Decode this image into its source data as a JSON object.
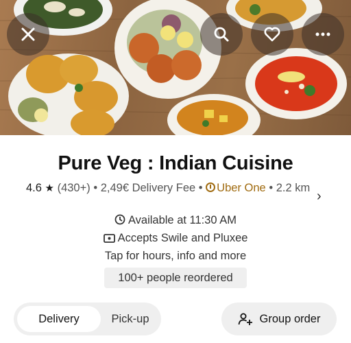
{
  "restaurant": {
    "name": "Pure Veg : Indian Cuisine",
    "rating": "4.6",
    "rating_count": "(430+)",
    "delivery_fee": "2,49€ Delivery Fee",
    "membership": "Uber One",
    "distance": "2.2 km",
    "availability": "Available at 11:30 AM",
    "payments": "Accepts Swile and Pluxee",
    "more_info": "Tap for hours, info and more",
    "reorder_badge": "100+ people reordered"
  },
  "fulfillment": {
    "options": [
      "Delivery",
      "Pick-up"
    ],
    "selected": "Delivery"
  },
  "actions": {
    "group_order": "Group order"
  },
  "icons": {
    "close": "close-icon",
    "search": "search-icon",
    "favorite": "heart-icon",
    "more": "more-icon",
    "rating": "star-icon",
    "uber_one": "uber-one-icon",
    "details": "chevron-right-icon",
    "availability": "clock-icon",
    "payments": "payment-card-icon",
    "group": "add-person-icon"
  },
  "colors": {
    "uber_one": "#a06b10",
    "chip_bg": "#efefef",
    "title": "#111111"
  }
}
